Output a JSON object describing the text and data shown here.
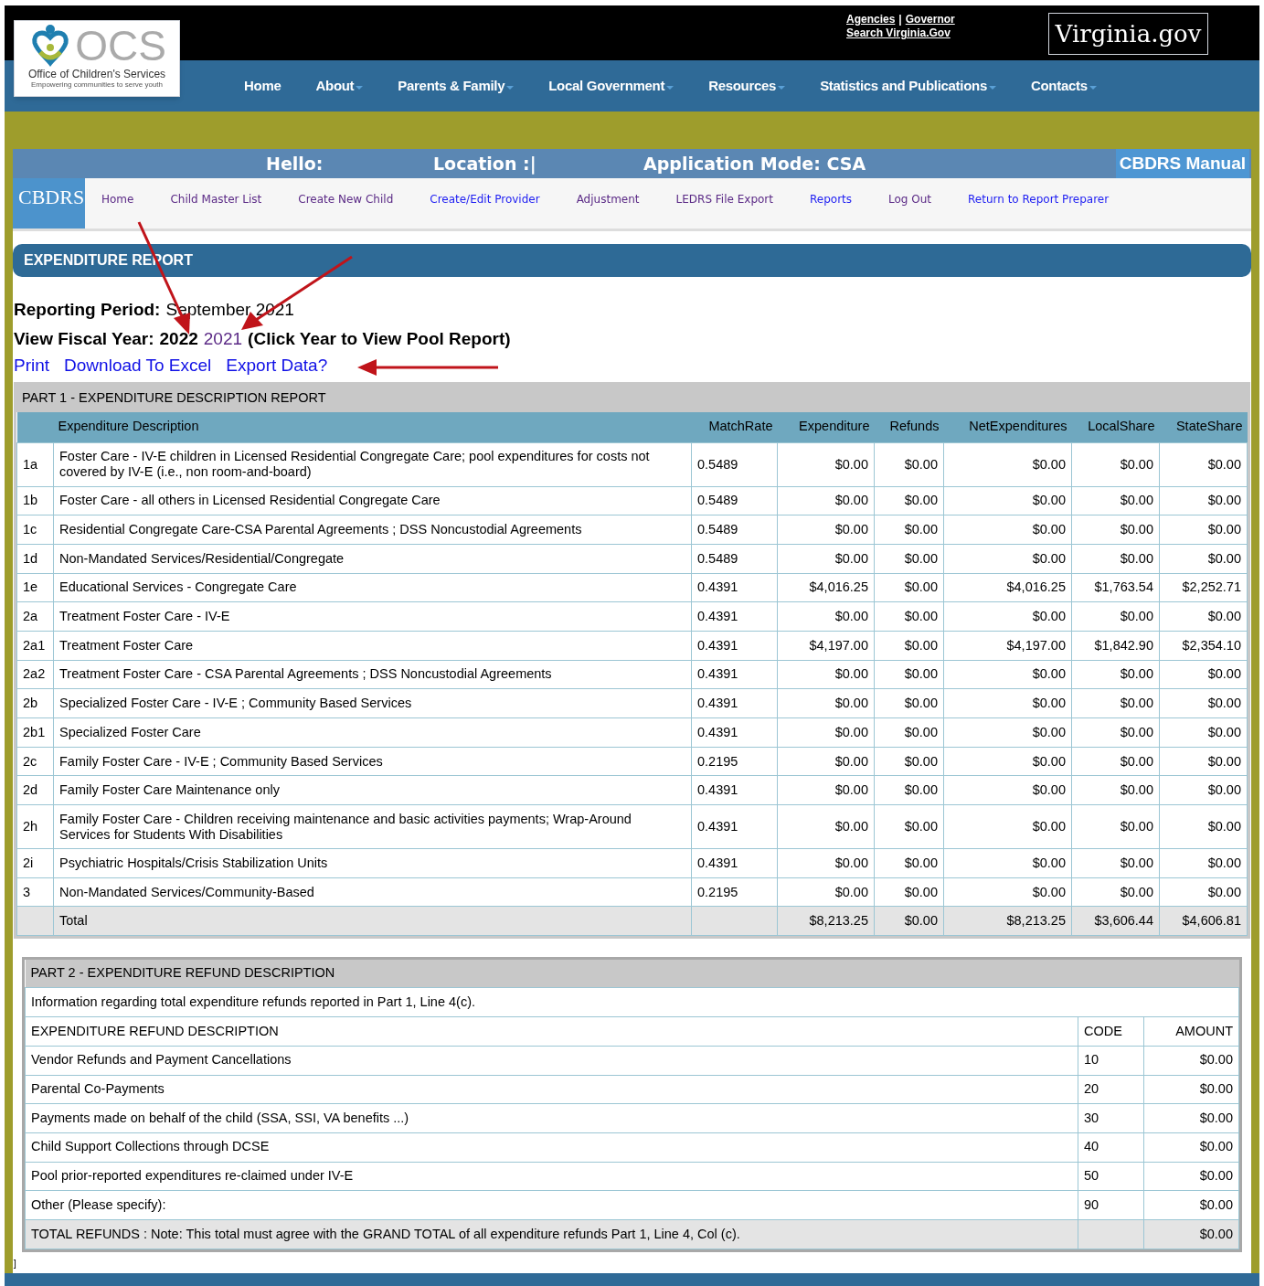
{
  "site_header": {
    "logo": {
      "mark": "OCS",
      "name": "Office of Children's Services",
      "tagline": "Empowering communities to serve youth"
    },
    "top_links": [
      {
        "label": "Agencies"
      },
      {
        "label": "Governor"
      },
      {
        "label": "Search Virginia.Gov"
      }
    ],
    "top_link_separator": "|",
    "state_logo": "Virginia.gov",
    "nav": [
      {
        "label": "Home",
        "has_dropdown": false
      },
      {
        "label": "About",
        "has_dropdown": true
      },
      {
        "label": "Parents & Family",
        "has_dropdown": true
      },
      {
        "label": "Local Government",
        "has_dropdown": true
      },
      {
        "label": "Resources",
        "has_dropdown": true
      },
      {
        "label": "Statistics and Publications",
        "has_dropdown": true
      },
      {
        "label": "Contacts",
        "has_dropdown": true
      }
    ]
  },
  "app_bar": {
    "hello": "Hello:",
    "location": "Location :|",
    "mode": "Application Mode: CSA",
    "manual": "CBDRS Manual",
    "brand": "CBDRS",
    "menu": [
      {
        "label": "Home",
        "visited": true
      },
      {
        "label": "Child Master List",
        "visited": true
      },
      {
        "label": "Create New Child",
        "visited": true
      },
      {
        "label": "Create/Edit Provider",
        "visited": false
      },
      {
        "label": "Adjustment",
        "visited": true
      },
      {
        "label": "LEDRS File Export",
        "visited": true
      },
      {
        "label": "Reports",
        "visited": false
      },
      {
        "label": "Log Out",
        "visited": true
      },
      {
        "label": "Return to Report Preparer",
        "visited": false
      }
    ]
  },
  "report": {
    "title": "EXPENDITURE REPORT",
    "period_label": "Reporting Period:",
    "period_value": "September 2021",
    "fiscal_year_label": "View Fiscal Year:",
    "years": [
      {
        "label": "2022",
        "link": false
      },
      {
        "label": "2021",
        "link": true
      }
    ],
    "year_note": "(Click Year to View Pool Report)",
    "actions": [
      {
        "label": "Print"
      },
      {
        "label": "Download To Excel"
      },
      {
        "label": "Export Data?"
      }
    ]
  },
  "part1": {
    "title": "PART 1 - EXPENDITURE DESCRIPTION REPORT",
    "columns": [
      null,
      "Expenditure Description",
      "MatchRate",
      "Expenditure",
      "Refunds",
      "NetExpenditures",
      "LocalShare",
      "StateShare"
    ],
    "rows": [
      [
        "1a",
        "Foster Care - IV-E children in Licensed Residential Congregate Care; pool expenditures for costs not covered by IV-E (i.e., non room-and-board)",
        "0.5489",
        "$0.00",
        "$0.00",
        "$0.00",
        "$0.00",
        "$0.00"
      ],
      [
        "1b",
        "Foster Care - all others in Licensed Residential Congregate Care",
        "0.5489",
        "$0.00",
        "$0.00",
        "$0.00",
        "$0.00",
        "$0.00"
      ],
      [
        "1c",
        "Residential Congregate Care-CSA Parental Agreements ; DSS Noncustodial Agreements",
        "0.5489",
        "$0.00",
        "$0.00",
        "$0.00",
        "$0.00",
        "$0.00"
      ],
      [
        "1d",
        "Non-Mandated Services/Residential/Congregate",
        "0.5489",
        "$0.00",
        "$0.00",
        "$0.00",
        "$0.00",
        "$0.00"
      ],
      [
        "1e",
        "Educational Services - Congregate Care",
        "0.4391",
        "$4,016.25",
        "$0.00",
        "$4,016.25",
        "$1,763.54",
        "$2,252.71"
      ],
      [
        "2a",
        "Treatment Foster Care - IV-E",
        "0.4391",
        "$0.00",
        "$0.00",
        "$0.00",
        "$0.00",
        "$0.00"
      ],
      [
        "2a1",
        "Treatment Foster Care",
        "0.4391",
        "$4,197.00",
        "$0.00",
        "$4,197.00",
        "$1,842.90",
        "$2,354.10"
      ],
      [
        "2a2",
        "Treatment Foster Care - CSA Parental Agreements ; DSS Noncustodial Agreements",
        "0.4391",
        "$0.00",
        "$0.00",
        "$0.00",
        "$0.00",
        "$0.00"
      ],
      [
        "2b",
        "Specialized Foster Care - IV-E ; Community Based Services",
        "0.4391",
        "$0.00",
        "$0.00",
        "$0.00",
        "$0.00",
        "$0.00"
      ],
      [
        "2b1",
        "Specialized Foster Care",
        "0.4391",
        "$0.00",
        "$0.00",
        "$0.00",
        "$0.00",
        "$0.00"
      ],
      [
        "2c",
        "Family Foster Care - IV-E ; Community Based Services",
        "0.2195",
        "$0.00",
        "$0.00",
        "$0.00",
        "$0.00",
        "$0.00"
      ],
      [
        "2d",
        "Family Foster Care Maintenance only",
        "0.4391",
        "$0.00",
        "$0.00",
        "$0.00",
        "$0.00",
        "$0.00"
      ],
      [
        "2h",
        "Family Foster Care - Children receiving maintenance and basic activities payments; Wrap-Around Services for Students With Disabilities",
        "0.4391",
        "$0.00",
        "$0.00",
        "$0.00",
        "$0.00",
        "$0.00"
      ],
      [
        "2i",
        "Psychiatric Hospitals/Crisis Stabilization Units",
        "0.4391",
        "$0.00",
        "$0.00",
        "$0.00",
        "$0.00",
        "$0.00"
      ],
      [
        "3",
        "Non-Mandated Services/Community-Based",
        "0.2195",
        "$0.00",
        "$0.00",
        "$0.00",
        "$0.00",
        "$0.00"
      ]
    ],
    "total": {
      "label": "Total",
      "expenditure": "$8,213.25",
      "refunds": "$0.00",
      "net_expenditures": "$8,213.25",
      "local_share": "$3,606.44",
      "state_share": "$4,606.81"
    }
  },
  "part2": {
    "title": "PART 2 - EXPENDITURE REFUND DESCRIPTION",
    "info": "Information regarding total expenditure refunds reported in Part 1, Line 4(c).",
    "columns": [
      "EXPENDITURE REFUND DESCRIPTION",
      "CODE",
      "AMOUNT"
    ],
    "rows": [
      [
        "Vendor Refunds and Payment Cancellations",
        "10",
        "$0.00"
      ],
      [
        "Parental Co-Payments",
        "20",
        "$0.00"
      ],
      [
        "Payments made on behalf of the child (SSA, SSI, VA benefits ...)",
        "30",
        "$0.00"
      ],
      [
        "Child Support Collections through DCSE",
        "40",
        "$0.00"
      ],
      [
        "Pool prior-reported expenditures re-claimed under IV-E",
        "50",
        "$0.00"
      ],
      [
        "Other (Please specify):",
        "90",
        "$0.00"
      ]
    ],
    "total": {
      "label": "TOTAL REFUNDS : Note: This total must agree with the GRAND TOTAL of all expenditure refunds Part 1, Line 4, Col (c).",
      "amount": "$0.00"
    }
  },
  "footer_mark": "]"
}
